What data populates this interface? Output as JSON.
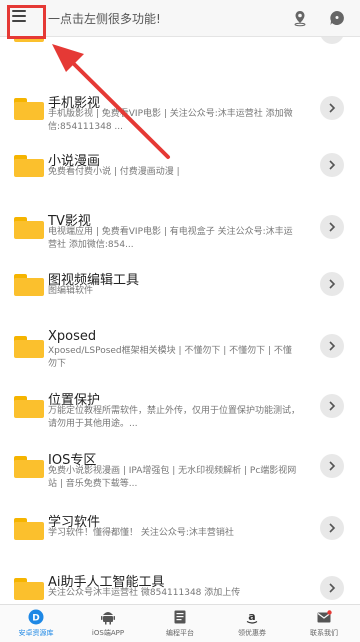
{
  "header": {
    "hint": "一点击左侧很多功能!",
    "icons": [
      "menu-icon",
      "location-icon",
      "chat-icon"
    ]
  },
  "items": [
    {
      "title": "",
      "desc": ""
    },
    {
      "title": "手机影视",
      "desc": "手机版影视 | 免费看VIP电影 | 关注公众号:沐丰运营社 添加微信:854111348 ..."
    },
    {
      "title": "小说漫画",
      "desc": "免费看付费小说 | 付费漫画动漫 |"
    },
    {
      "title": "TV影视",
      "desc": "电视端应用 | 免费看VIP电影 | 有电视盒子 关注公众号:沐丰运营社 添加微信:854..."
    },
    {
      "title": "图视频编辑工具",
      "desc": "图编辑软件"
    },
    {
      "title": "Xposed",
      "desc": "Xposed/LSPosed框架相关模块 | 不懂勿下 | 不懂勿下 | 不懂勿下"
    },
    {
      "title": "位置保护",
      "desc": "万能定位教程所需软件，禁止外传，仅用于位置保护功能测试，请勿用于其他用途。..."
    },
    {
      "title": "IOS专区",
      "desc": "免费小说影视漫画 | IPA增强包 | 无水印视频解析 | Pc端影视网站 | 音乐免费下载等..."
    },
    {
      "title": "学习软件",
      "desc": "学习软件！懂得都懂！ 关注公众号:沐丰营销社"
    },
    {
      "title": "Ai助手人工智能工具",
      "desc": "关注公众号沐丰运营社 微854111348 添加上传"
    }
  ],
  "bottom_nav": [
    {
      "label": "安卓资源库",
      "icon": "android-resource-icon",
      "active": true
    },
    {
      "label": "iOS端APP",
      "icon": "android-robot-icon",
      "active": false
    },
    {
      "label": "编程平台",
      "icon": "document-icon",
      "active": false
    },
    {
      "label": "领优惠券",
      "icon": "amazon-icon",
      "active": false
    },
    {
      "label": "联系我们",
      "icon": "mail-icon",
      "active": false
    }
  ],
  "colors": {
    "accent": "#1e88e5",
    "folder": "#fbc02d",
    "annotation": "#e53935"
  }
}
